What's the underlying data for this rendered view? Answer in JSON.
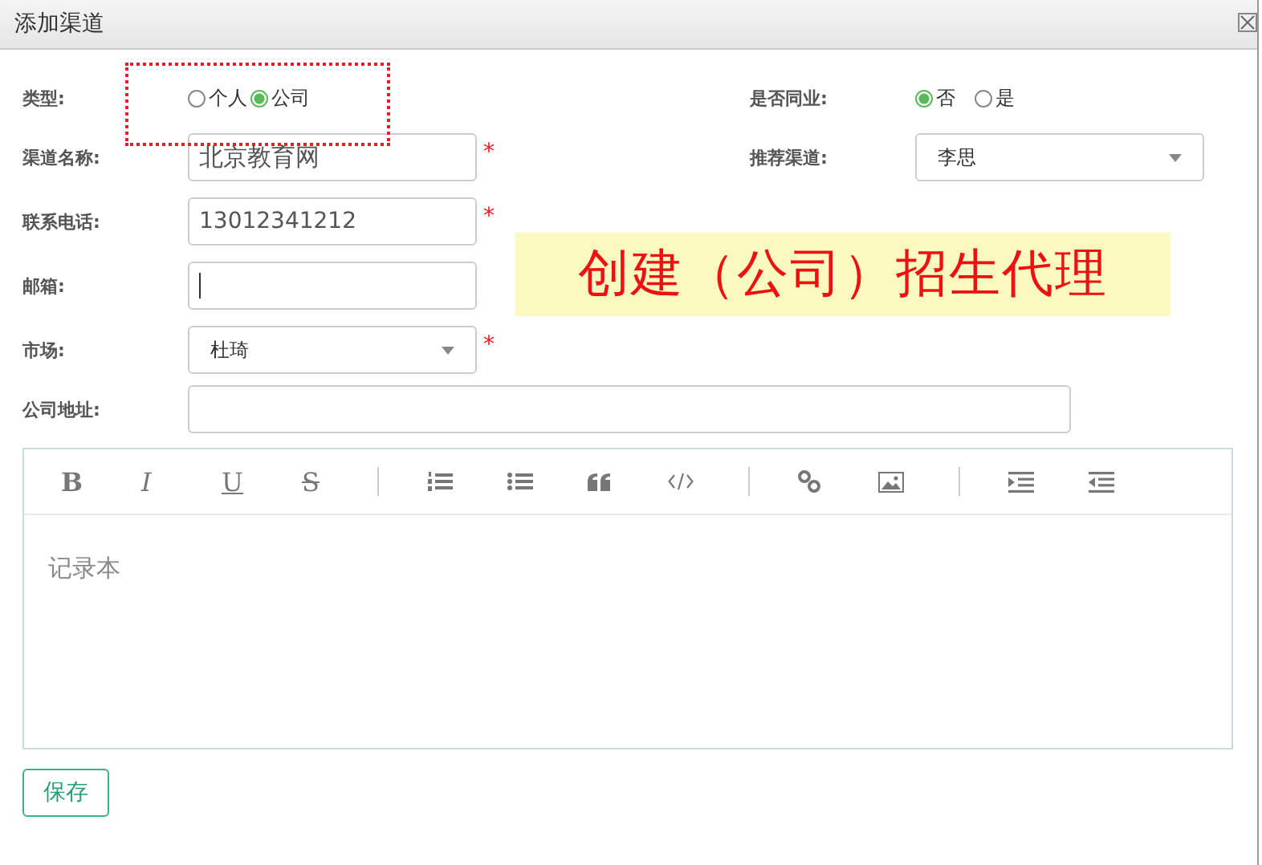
{
  "window": {
    "title": "添加渠道"
  },
  "type_field": {
    "label": "类型:",
    "options": [
      {
        "label": "个人",
        "selected": false
      },
      {
        "label": "公司",
        "selected": true
      }
    ]
  },
  "peer_field": {
    "label": "是否同业:",
    "options": [
      {
        "label": "否",
        "selected": true
      },
      {
        "label": "是",
        "selected": false
      }
    ]
  },
  "channel_name": {
    "label": "渠道名称:",
    "value": "北京教育网",
    "required_mark": "*"
  },
  "referral": {
    "label": "推荐渠道:",
    "value": "李思"
  },
  "phone": {
    "label": "联系电话:",
    "value": "13012341212",
    "required_mark": "*"
  },
  "email": {
    "label": "邮箱:"
  },
  "market": {
    "label": "市场:",
    "value": "杜琦",
    "required_mark": "*"
  },
  "address": {
    "label": "公司地址:"
  },
  "banner": "创建（公司）招生代理",
  "editor": {
    "placeholder": "记录本",
    "toolbar": [
      {
        "kind": "bold",
        "label": "B"
      },
      {
        "kind": "italic",
        "label": "I"
      },
      {
        "kind": "underline",
        "label": "U"
      },
      {
        "kind": "strike",
        "label": "S"
      },
      {
        "kind": "separator"
      },
      {
        "kind": "ordered-list"
      },
      {
        "kind": "bullet-list"
      },
      {
        "kind": "quote"
      },
      {
        "kind": "code"
      },
      {
        "kind": "separator"
      },
      {
        "kind": "link"
      },
      {
        "kind": "image"
      },
      {
        "kind": "separator"
      },
      {
        "kind": "indent"
      },
      {
        "kind": "outdent"
      }
    ]
  },
  "buttons": [
    "保存"
  ]
}
